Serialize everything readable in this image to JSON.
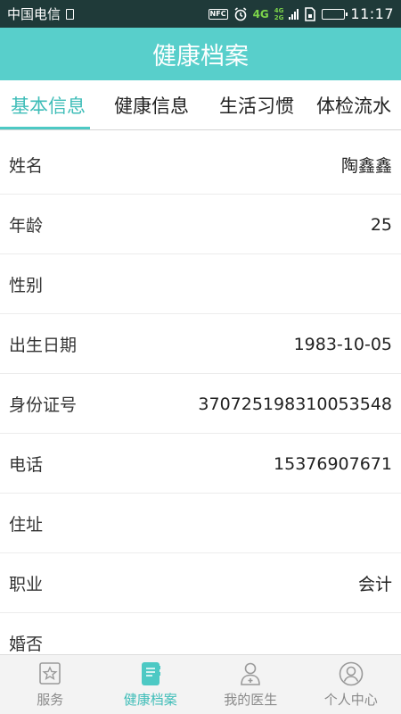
{
  "status_bar": {
    "carrier": "中国电信",
    "nfc": "NFC",
    "network_4g": "4G",
    "dual_top": "4G",
    "dual_bottom": "2G",
    "time": "11:17",
    "icons": [
      "sim-icon",
      "nfc-icon",
      "alarm-icon",
      "signal-icon",
      "sim-card-icon",
      "battery-icon"
    ]
  },
  "header": {
    "title": "健康档案"
  },
  "tabs": [
    {
      "label": "基本信息",
      "active": true
    },
    {
      "label": "健康信息",
      "active": false
    },
    {
      "label": "生活习惯",
      "active": false
    },
    {
      "label": "体检流水",
      "active": false
    }
  ],
  "profile": {
    "rows": [
      {
        "label": "姓名",
        "value": "陶鑫鑫"
      },
      {
        "label": "年龄",
        "value": "25"
      },
      {
        "label": "性别",
        "value": ""
      },
      {
        "label": "出生日期",
        "value": "1983-10-05"
      },
      {
        "label": "身份证号",
        "value": "370725198310053548"
      },
      {
        "label": "电话",
        "value": "15376907671"
      },
      {
        "label": "住址",
        "value": ""
      },
      {
        "label": "职业",
        "value": "会计"
      },
      {
        "label": "婚否",
        "value": ""
      }
    ]
  },
  "bottom_nav": {
    "items": [
      {
        "label": "服务",
        "icon": "star-badge-icon",
        "active": false
      },
      {
        "label": "健康档案",
        "icon": "notebook-icon",
        "active": true
      },
      {
        "label": "我的医生",
        "icon": "doctor-icon",
        "active": false
      },
      {
        "label": "个人中心",
        "icon": "user-icon",
        "active": false
      }
    ]
  },
  "colors": {
    "accent": "#58cfcb",
    "active_text": "#3fbdb8",
    "status_bar": "#1f3a39"
  }
}
